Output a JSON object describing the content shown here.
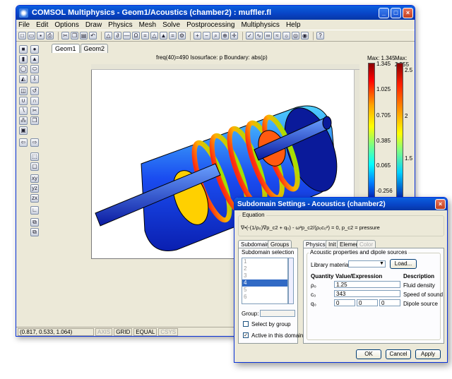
{
  "main": {
    "title": "COMSOL Multiphysics - Geom1/Acoustics (chamber2) : muffler.fl",
    "menu": [
      "File",
      "Edit",
      "Options",
      "Draw",
      "Physics",
      "Mesh",
      "Solve",
      "Postprocessing",
      "Multiphysics",
      "Help"
    ],
    "tabs": [
      "Geom1",
      "Geom2"
    ],
    "plot_title": "freq(40)=490 Isosurface: p Boundary: abs(p)",
    "colorbar1": {
      "max_label": "Max: 1.345",
      "ticks": [
        "1.345",
        "1.025",
        "0.705",
        "0.385",
        "0.065",
        "-0.256"
      ]
    },
    "colorbar2": {
      "max_label": "Max: 2.555",
      "ticks": [
        "2.5",
        "2",
        "1.5"
      ]
    },
    "status": {
      "coords": "(0.817, 0.533, 1.064)",
      "buttons": [
        "AXIS",
        "GRID",
        "EQUAL",
        "CSYS"
      ]
    }
  },
  "dialog": {
    "title": "Subdomain Settings - Acoustics (chamber2)",
    "equation_label": "Equation",
    "equation": "∇•(-(1/ρ₀)∇p_c2 + q₀) - ω²p_c2/(ρ₀c₀²) = 0, p_c2 = pressure",
    "left_tabs": [
      "Subdomains",
      "Groups"
    ],
    "subdomain_selection_label": "Subdomain selection",
    "subdomains": [
      "1",
      "2",
      "3",
      "4",
      "5",
      "6"
    ],
    "selected_subdomain": "4",
    "group_label": "Group:",
    "select_by_group": "Select by group",
    "active_in_domain": "Active in this domain",
    "right_tabs": [
      "Physics",
      "Init",
      "Element",
      "Color"
    ],
    "section_label": "Acoustic properties and dipole sources",
    "library_material_label": "Library material:",
    "load_button": "Load...",
    "headers": [
      "Quantity",
      "Value/Expression",
      "Description"
    ],
    "rows": [
      {
        "quantity": "ρ₀",
        "value": "1.25",
        "description": "Fluid density"
      },
      {
        "quantity": "c₀",
        "value": "343",
        "description": "Speed of sound"
      },
      {
        "quantity": "q₀",
        "values": [
          "0",
          "0",
          "0"
        ],
        "description": "Dipole source"
      }
    ],
    "buttons": {
      "ok": "OK",
      "cancel": "Cancel",
      "apply": "Apply"
    }
  }
}
